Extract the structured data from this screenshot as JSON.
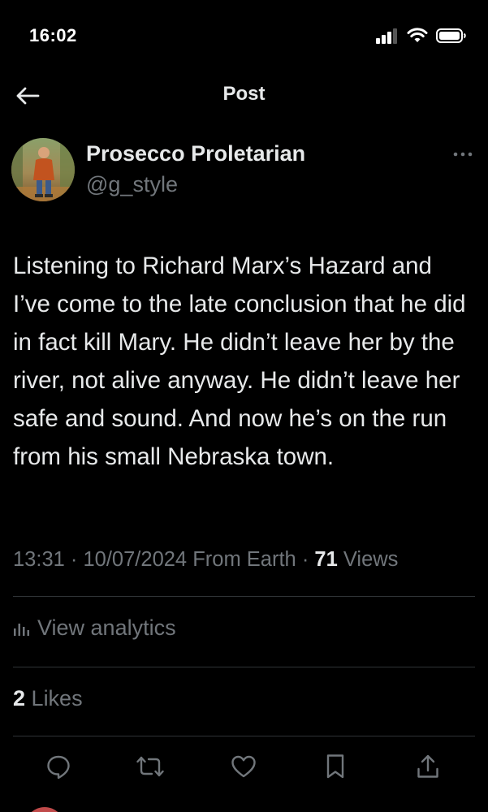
{
  "status_bar": {
    "time": "16:02"
  },
  "nav": {
    "title": "Post"
  },
  "author": {
    "name": "Prosecco Proletarian",
    "handle": "@g_style"
  },
  "post": {
    "text": "Listening to Richard Marx’s Hazard and I’ve come to the late conclusion that he did in fact kill Mary. He didn’t leave her by the river, not alive anyway. He didn’t leave her safe and sound. And now he’s on the run from his small Nebraska town.",
    "time": "13:31",
    "date": "10/07/2024",
    "source": "From Earth",
    "views_count": "71",
    "views_label": "Views"
  },
  "analytics": {
    "label": "View analytics"
  },
  "likes": {
    "count": "2",
    "label": "Likes"
  },
  "actions": [
    "reply-icon",
    "repost-icon",
    "like-icon",
    "bookmark-icon",
    "share-icon"
  ],
  "colors": {
    "background": "#000000",
    "primary_text": "#e7e9ea",
    "secondary_text": "#71767b",
    "divider": "#2f3336"
  }
}
